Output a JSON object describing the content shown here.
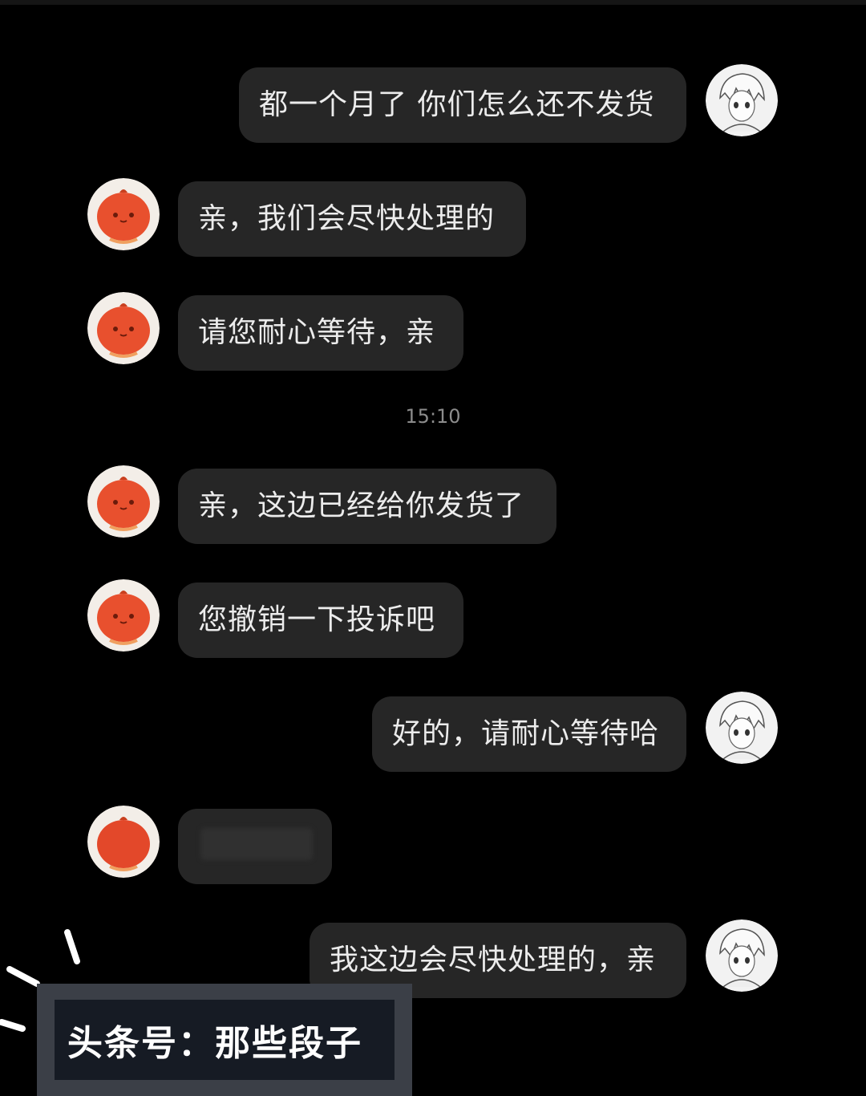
{
  "messages": [
    {
      "side": "right",
      "text": "都一个月了 你们怎么还不发货"
    },
    {
      "side": "left",
      "text": "亲，我们会尽快处理的"
    },
    {
      "side": "left",
      "text": "请您耐心等待，亲"
    },
    {
      "side": "left",
      "text": "亲，这边已经给你发货了"
    },
    {
      "side": "left",
      "text": "您撤销一下投诉吧"
    },
    {
      "side": "right",
      "text": "好的，请耐心等待哈"
    },
    {
      "side": "left",
      "text": ""
    },
    {
      "side": "right",
      "text": "我这边会尽快处理的，亲"
    }
  ],
  "timestamp": "15:10",
  "watermark": "头条号：那些段子",
  "avatars": {
    "user": "anime-character-avatar-icon",
    "seller": "orange-pumpkin-avatar-icon"
  },
  "colors": {
    "background": "#000000",
    "bubble": "#262626",
    "text": "#ececec",
    "seller_avatar": "#e8502e"
  }
}
